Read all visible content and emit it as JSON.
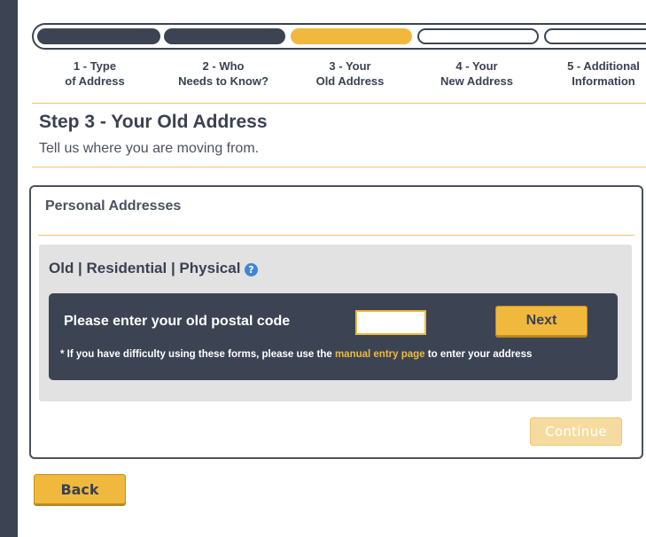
{
  "progress": {
    "steps": [
      {
        "line1": "1 - Type",
        "line2": "of Address",
        "state": "done"
      },
      {
        "line1": "2 - Who",
        "line2": "Needs to Know?",
        "state": "done"
      },
      {
        "line1": "3 - Your",
        "line2": "Old Address",
        "state": "current"
      },
      {
        "line1": "4 - Your",
        "line2": "New Address",
        "state": "todo"
      },
      {
        "line1": "5 - Additional",
        "line2": "Information",
        "state": "todo"
      }
    ]
  },
  "header": {
    "title": "Step 3 - Your Old Address",
    "subtitle": "Tell us where you are moving from."
  },
  "card": {
    "title": "Personal Addresses",
    "section_title": "Old | Residential | Physical",
    "help_icon": "question-circle-icon",
    "postal_label": "Please enter your old postal code",
    "postal_value": "",
    "next_label": "Next",
    "note_prefix": "* If you have difficulty using these forms, please use the ",
    "note_link": "manual entry page",
    "note_suffix": " to enter your address",
    "continue_label": "Continue"
  },
  "footer": {
    "back_label": "Back"
  },
  "colors": {
    "navy": "#3c4453",
    "gold": "#f0b93e",
    "gold_disabled": "#f6dba0",
    "help_blue": "#3f86d4"
  }
}
